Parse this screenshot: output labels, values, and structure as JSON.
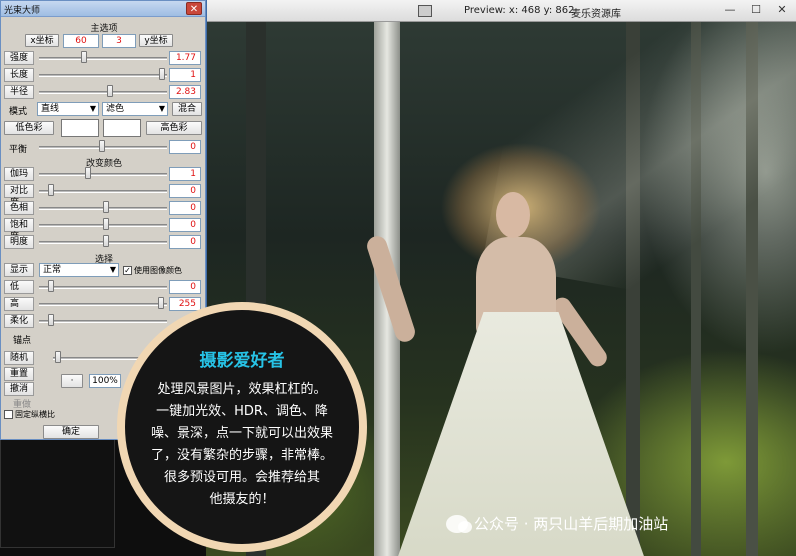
{
  "panel": {
    "title": "光束大师",
    "main_section": "主选项",
    "x_label": "x坐标",
    "x_value": "60",
    "y_value": "3",
    "y_label": "y坐标",
    "rows": [
      {
        "label": "强度",
        "value": "1.77"
      },
      {
        "label": "长度",
        "value": "1"
      },
      {
        "label": "半径",
        "value": "2.83"
      }
    ],
    "mode_label": "模式",
    "mode_value": "直线",
    "blend_value": "滤色",
    "mix_button": "混合",
    "light_color_button": "低色彩",
    "dark_color_button": "高色彩",
    "balance_label": "平衡",
    "balance_value": "0",
    "color_section": "改变颜色",
    "color_rows": [
      {
        "label": "伽玛",
        "value": "1"
      },
      {
        "label": "对比度",
        "value": "0"
      },
      {
        "label": "色相",
        "value": "0"
      },
      {
        "label": "饱和度",
        "value": "0"
      },
      {
        "label": "明度",
        "value": "0"
      }
    ],
    "select_section": "选择",
    "display_label": "显示",
    "display_value": "正常",
    "use_image_color": "使用图像颜色",
    "range_rows": [
      {
        "label": "低",
        "value": "0"
      },
      {
        "label": "高",
        "value": "255"
      }
    ],
    "soften_label": "柔化",
    "anchor_label": "锚点",
    "random_label": "随机",
    "reset_label": "重置",
    "undo_label": "撤消",
    "redo_label": "重做",
    "dot_button": "·",
    "zoom_value": "100%",
    "fixed_ratio_label": "固定纵横比",
    "ok_button": "确定"
  },
  "preview": {
    "coords": "Preview: x: 468 y: 862",
    "brand": "麦乐资源库"
  },
  "badge": {
    "title": "摄影爱好者",
    "lines": [
      "处理风景图片，效果杠杠的。",
      "一键加光效、HDR、调色、降",
      "噪、景深，点一下就可以出效果",
      "了，没有繁杂的步骤，非常棒。",
      "很多预设可用。会推荐给其",
      "他摄友的！"
    ]
  },
  "watermark": "公众号 · 两只山羊后期加油站"
}
